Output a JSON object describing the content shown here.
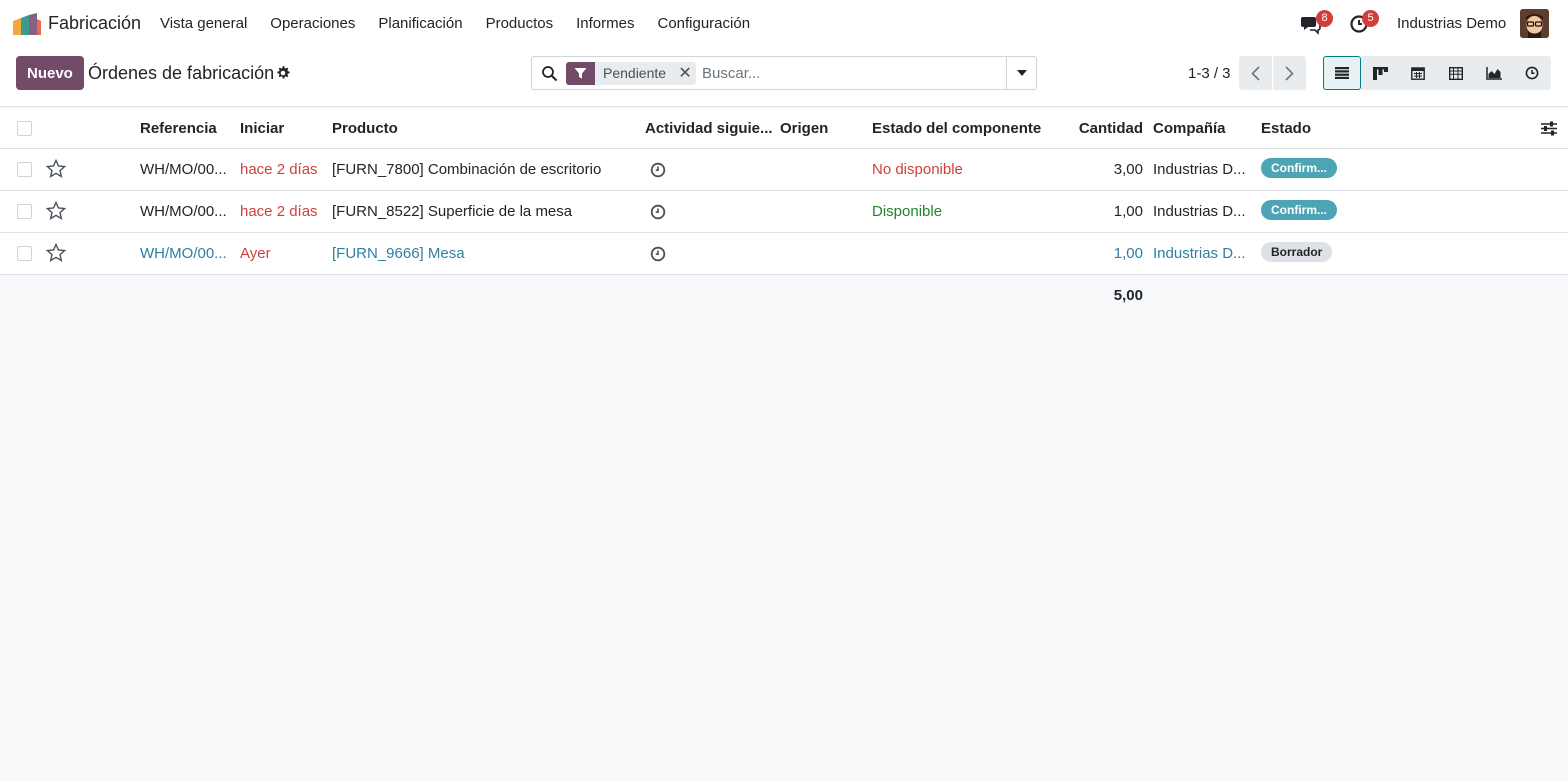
{
  "navbar": {
    "app_name": "Fabricación",
    "menu": [
      "Vista general",
      "Operaciones",
      "Planificación",
      "Productos",
      "Informes",
      "Configuración"
    ],
    "messages_badge": "8",
    "activities_badge": "5",
    "company": "Industrias Demo",
    "icons": [
      "app-logo",
      "chat-icon",
      "clock-icon",
      "avatar"
    ]
  },
  "control": {
    "new_label": "Nuevo",
    "title": "Órdenes de fabricación",
    "facet_label": "Pendiente",
    "search_placeholder": "Buscar...",
    "pager": "1-3 / 3",
    "views": [
      "list-view",
      "kanban-view",
      "calendar-view",
      "pivot-view",
      "graph-view",
      "activity-view"
    ],
    "active_view": "list-view",
    "colors": {
      "brand": "#714b67",
      "accent": "#017e84"
    }
  },
  "table": {
    "headers": {
      "reference": "Referencia",
      "start": "Iniciar",
      "product": "Producto",
      "next_activity": "Actividad siguie...",
      "origin": "Origen",
      "component_status": "Estado del componente",
      "quantity": "Cantidad",
      "company": "Compañía",
      "state": "Estado"
    },
    "rows": [
      {
        "reference": "WH/MO/00...",
        "start": "hace 2 días",
        "product": "[FURN_7800] Combinación de escritorio",
        "origin": "",
        "component_status": "No disponible",
        "quantity": "3,00",
        "company": "Industrias D...",
        "state": "Confirm..."
      },
      {
        "reference": "WH/MO/00...",
        "start": "hace 2 días",
        "product": "[FURN_8522] Superficie de la mesa",
        "origin": "",
        "component_status": "Disponible",
        "quantity": "1,00",
        "company": "Industrias D...",
        "state": "Confirm..."
      },
      {
        "reference": "WH/MO/00...",
        "start": "Ayer",
        "product": "[FURN_9666] Mesa",
        "origin": "",
        "component_status": "",
        "quantity": "1,00",
        "company": "Industrias D...",
        "state": "Borrador"
      }
    ],
    "total_quantity": "5,00"
  }
}
